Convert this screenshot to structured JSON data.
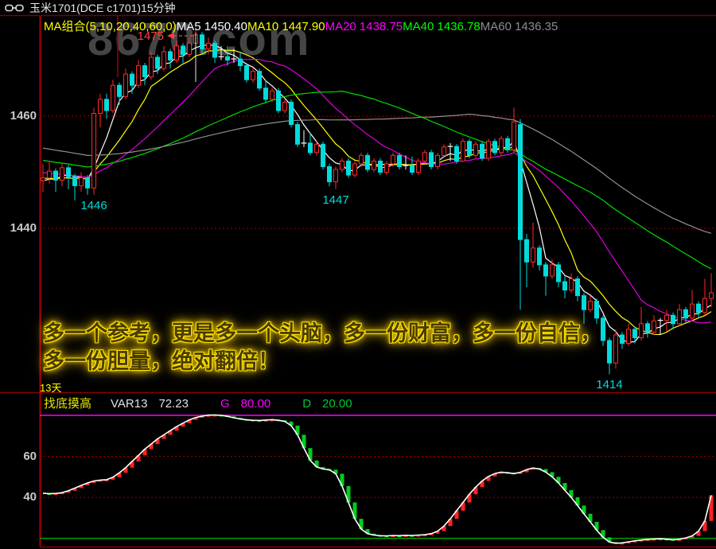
{
  "app": {
    "title": "玉米1701(DCE c1701)15分钟"
  },
  "ma_bar": {
    "group_label": "MA组合(5,10,20,40,60,0)",
    "items": [
      {
        "label": "MA5 1450.40",
        "color": "#ffffff"
      },
      {
        "label": "MA10 1447.90",
        "color": "#ffff00"
      },
      {
        "label": "MA20 1438.75",
        "color": "#ff00ff"
      },
      {
        "label": "MA40 1436.78",
        "color": "#00ff00"
      },
      {
        "label": "MA60 1436.35",
        "color": "#8c8c8c"
      }
    ]
  },
  "watermark": "8670.com",
  "overlay_text": {
    "line1": "多一个参考，更是多一个头脑，多一份财富，多一份自信，",
    "line2": "多一份胆量，绝对翻倍！"
  },
  "period_label": "13天",
  "indicator_header": {
    "name": "找底摸高",
    "var_label": "VAR13",
    "var_value": "72.23",
    "g_label": "G",
    "g_value": "80.00",
    "d_label": "D",
    "d_value": "20.00"
  },
  "colors": {
    "up": "#ff2a2a",
    "down": "#00dcdc",
    "doji": "#ffffff",
    "ma": [
      "#ffffff",
      "#ffff00",
      "#e000e0",
      "#00dd00",
      "#909090"
    ],
    "grid": "#9c0000",
    "axis": "#b40000",
    "separator": "#7a0000",
    "bottom_border": "#6e0000",
    "overbought_line": "#ff00ff",
    "oversold_line": "#00a000",
    "bar_up": "#ff2222",
    "bar_down": "#00cc22",
    "curve": "#ffffff",
    "label_gray": "#c8c8c8",
    "label_cyan": "#00dcdc",
    "label_red": "#ff4040",
    "cursor_line": "#e8e8e8",
    "accent_yellow": "#ffff00"
  },
  "chart_data": [
    {
      "type": "candlestick",
      "symbol": "玉米1701(DCE c1701)",
      "interval": "15分钟",
      "ylim": [
        1411,
        1478
      ],
      "y_ticks": [
        {
          "label": "1460",
          "value": 1460
        },
        {
          "label": "1440",
          "value": 1440
        }
      ],
      "gridline_values": [
        1460,
        1440
      ],
      "ma_periods": [
        5,
        10,
        20,
        40,
        60
      ],
      "lead_in": {
        "start": 1461,
        "end": 1448,
        "count": 60
      },
      "annotations": [
        {
          "type": "high-pointer",
          "text": "1475",
          "x_index": 24,
          "price": 1475.4
        },
        {
          "type": "low-label",
          "text": "1446",
          "x_index": 8,
          "price": 1446
        },
        {
          "type": "low-label",
          "text": "1447",
          "x_index": 46,
          "price": 1447
        },
        {
          "type": "low-label",
          "text": "1414",
          "x_index": 89,
          "price": 1414
        }
      ],
      "candles": [
        [
          1448.5,
          1451.5,
          1446.5,
          1449.0
        ],
        [
          1449.0,
          1452.0,
          1448.0,
          1450.2
        ],
        [
          1450.2,
          1450.7,
          1446.5,
          1448.6
        ],
        [
          1448.6,
          1451.5,
          1447.5,
          1450.8
        ],
        [
          1450.8,
          1451.3,
          1447.0,
          1449.2
        ],
        [
          1449.2,
          1449.7,
          1445.0,
          1447.6
        ],
        [
          1447.6,
          1450.0,
          1446.5,
          1449.0
        ],
        [
          1449.0,
          1449.5,
          1446.0,
          1447.2
        ],
        [
          1447.2,
          1461.5,
          1446.0,
          1460.5
        ],
        [
          1460.5,
          1464.0,
          1458.0,
          1463.0
        ],
        [
          1463.0,
          1464.0,
          1459.5,
          1461.0
        ],
        [
          1461.0,
          1466.5,
          1460.5,
          1465.5
        ],
        [
          1465.5,
          1466.0,
          1462.0,
          1463.5
        ],
        [
          1463.5,
          1468.5,
          1463.0,
          1467.5
        ],
        [
          1467.5,
          1468.0,
          1464.0,
          1465.5
        ],
        [
          1465.5,
          1470.0,
          1465.0,
          1469.0
        ],
        [
          1469.0,
          1469.5,
          1465.5,
          1467.0
        ],
        [
          1467.0,
          1471.5,
          1466.5,
          1470.5
        ],
        [
          1470.5,
          1471.0,
          1467.5,
          1468.5
        ],
        [
          1468.5,
          1472.5,
          1468.0,
          1471.5
        ],
        [
          1471.5,
          1472.0,
          1468.5,
          1470.0
        ],
        [
          1470.0,
          1473.5,
          1469.5,
          1472.5
        ],
        [
          1472.5,
          1473.0,
          1469.5,
          1471.0
        ],
        [
          1471.0,
          1474.0,
          1470.5,
          1473.0
        ],
        [
          1473.0,
          1475.4,
          1471.5,
          1474.5
        ],
        [
          1474.5,
          1475.0,
          1471.0,
          1472.0
        ],
        [
          1472.0,
          1474.0,
          1471.0,
          1473.0
        ],
        [
          1473.0,
          1473.5,
          1469.5,
          1470.5
        ],
        [
          1470.5,
          1472.5,
          1470.0,
          1470.6
        ],
        [
          1470.6,
          1472.5,
          1469.0,
          1470.0
        ],
        [
          1470.0,
          1472.0,
          1469.5,
          1470.2
        ],
        [
          1470.2,
          1471.5,
          1468.0,
          1469.0
        ],
        [
          1469.0,
          1469.5,
          1466.0,
          1466.5
        ],
        [
          1466.5,
          1468.5,
          1466.0,
          1468.0
        ],
        [
          1468.0,
          1468.5,
          1464.5,
          1465.0
        ],
        [
          1465.0,
          1466.5,
          1462.5,
          1463.0
        ],
        [
          1463.0,
          1465.0,
          1462.5,
          1464.5
        ],
        [
          1464.5,
          1465.0,
          1460.5,
          1461.0
        ],
        [
          1461.0,
          1463.0,
          1460.5,
          1462.5
        ],
        [
          1462.5,
          1463.0,
          1458.0,
          1458.5
        ],
        [
          1458.5,
          1459.0,
          1454.5,
          1455.0
        ],
        [
          1455.0,
          1457.5,
          1454.5,
          1455.2
        ],
        [
          1455.2,
          1457.0,
          1453.0,
          1453.5
        ],
        [
          1453.5,
          1455.5,
          1453.0,
          1455.0
        ],
        [
          1455.0,
          1455.5,
          1450.5,
          1451.0
        ],
        [
          1451.0,
          1451.5,
          1447.5,
          1448.3
        ],
        [
          1448.3,
          1451.0,
          1447.0,
          1450.5
        ],
        [
          1450.5,
          1452.5,
          1450.0,
          1452.0
        ],
        [
          1452.0,
          1452.5,
          1449.0,
          1449.5
        ],
        [
          1449.5,
          1452.0,
          1449.0,
          1451.5
        ],
        [
          1451.5,
          1453.5,
          1451.0,
          1453.0
        ],
        [
          1453.0,
          1453.5,
          1450.0,
          1450.5
        ],
        [
          1450.5,
          1452.5,
          1450.0,
          1452.0
        ],
        [
          1452.0,
          1452.5,
          1449.5,
          1450.0
        ],
        [
          1450.0,
          1452.0,
          1449.5,
          1451.5
        ],
        [
          1451.5,
          1453.5,
          1451.0,
          1453.0
        ],
        [
          1453.0,
          1453.5,
          1450.5,
          1451.0
        ],
        [
          1451.0,
          1453.0,
          1450.5,
          1451.2
        ],
        [
          1451.2,
          1452.8,
          1449.5,
          1450.0
        ],
        [
          1450.0,
          1452.5,
          1449.5,
          1452.0
        ],
        [
          1452.0,
          1454.0,
          1451.5,
          1453.5
        ],
        [
          1453.5,
          1454.0,
          1450.5,
          1451.0
        ],
        [
          1451.0,
          1453.5,
          1450.5,
          1453.0
        ],
        [
          1453.0,
          1455.0,
          1452.5,
          1454.5
        ],
        [
          1454.5,
          1455.2,
          1452.0,
          1454.6
        ],
        [
          1454.6,
          1455.0,
          1451.5,
          1452.0
        ],
        [
          1452.0,
          1456.0,
          1451.8,
          1455.5
        ],
        [
          1455.5,
          1456.0,
          1452.5,
          1453.0
        ],
        [
          1453.0,
          1455.5,
          1452.5,
          1455.0
        ],
        [
          1455.0,
          1455.5,
          1452.0,
          1452.5
        ],
        [
          1452.5,
          1456.0,
          1452.0,
          1455.5
        ],
        [
          1455.5,
          1456.0,
          1453.0,
          1453.5
        ],
        [
          1453.5,
          1456.5,
          1453.0,
          1456.0
        ],
        [
          1456.0,
          1456.5,
          1453.5,
          1454.0
        ],
        [
          1454.0,
          1461.5,
          1453.5,
          1459.0
        ],
        [
          1458.5,
          1459.5,
          1425.5,
          1438.0
        ],
        [
          1438.0,
          1439.0,
          1429.5,
          1434.0
        ],
        [
          1434.0,
          1441.0,
          1433.0,
          1436.5
        ],
        [
          1436.5,
          1437.0,
          1432.5,
          1433.5
        ],
        [
          1433.5,
          1434.0,
          1428.0,
          1431.5
        ],
        [
          1431.5,
          1434.5,
          1431.0,
          1433.5
        ],
        [
          1433.5,
          1434.0,
          1429.5,
          1430.5
        ],
        [
          1430.5,
          1431.5,
          1427.5,
          1429.0
        ],
        [
          1429.0,
          1432.0,
          1428.5,
          1431.0
        ],
        [
          1431.0,
          1431.5,
          1427.0,
          1428.0
        ],
        [
          1428.0,
          1428.5,
          1423.0,
          1425.5
        ],
        [
          1425.5,
          1428.0,
          1425.0,
          1427.0
        ],
        [
          1427.0,
          1427.5,
          1423.0,
          1424.0
        ],
        [
          1424.0,
          1424.5,
          1419.0,
          1420.0
        ],
        [
          1420.0,
          1420.5,
          1414.0,
          1416.0
        ],
        [
          1416.0,
          1422.0,
          1415.0,
          1421.0
        ],
        [
          1421.0,
          1421.5,
          1418.5,
          1419.5
        ],
        [
          1419.5,
          1423.0,
          1419.0,
          1422.0
        ],
        [
          1422.0,
          1422.5,
          1419.5,
          1420.5
        ],
        [
          1420.5,
          1426.0,
          1420.0,
          1423.0
        ],
        [
          1423.0,
          1423.5,
          1420.5,
          1421.5
        ],
        [
          1421.5,
          1424.5,
          1421.0,
          1423.5
        ],
        [
          1423.5,
          1424.0,
          1421.0,
          1423.6
        ],
        [
          1423.6,
          1425.5,
          1421.5,
          1424.5
        ],
        [
          1424.5,
          1425.0,
          1422.0,
          1423.0
        ],
        [
          1423.0,
          1426.5,
          1422.5,
          1425.5
        ],
        [
          1425.5,
          1426.0,
          1423.0,
          1424.0
        ],
        [
          1424.0,
          1429.0,
          1423.5,
          1426.5
        ],
        [
          1426.5,
          1427.0,
          1424.0,
          1425.0
        ],
        [
          1425.0,
          1431.0,
          1424.5,
          1427.5
        ],
        [
          1427.5,
          1432.0,
          1426.0,
          1428.5
        ]
      ]
    },
    {
      "type": "bar",
      "name": "VAR13",
      "ylim": [
        16,
        83
      ],
      "y_ticks": [
        {
          "label": "60",
          "value": 60
        },
        {
          "label": "40",
          "value": 40
        }
      ],
      "gridline_values": [
        60,
        40
      ],
      "hlines": [
        {
          "value": 80,
          "color": "#ff00ff"
        },
        {
          "value": 20,
          "color": "#00a000"
        }
      ],
      "values": [
        42.0,
        41.8,
        41.9,
        42.3,
        43.2,
        44.5,
        45.8,
        47.0,
        48.0,
        48.4,
        48.6,
        49.8,
        52.0,
        54.5,
        57.5,
        60.5,
        63.5,
        66.0,
        68.5,
        70.5,
        72.5,
        74.5,
        76.2,
        77.8,
        78.9,
        79.6,
        80.1,
        80.2,
        80.0,
        79.5,
        78.8,
        78.2,
        77.8,
        77.6,
        77.5,
        77.7,
        77.9,
        77.6,
        77.0,
        75.0,
        70.5,
        64.0,
        58.0,
        54.8,
        53.8,
        53.5,
        51.5,
        45.5,
        37.5,
        29.5,
        24.5,
        22.3,
        21.6,
        21.3,
        21.2,
        21.4,
        21.3,
        21.5,
        21.4,
        21.6,
        21.8,
        22.3,
        23.5,
        26.0,
        29.5,
        33.5,
        37.5,
        41.5,
        45.0,
        48.0,
        50.2,
        51.6,
        52.3,
        52.0,
        51.6,
        52.2,
        53.5,
        54.3,
        53.8,
        52.3,
        50.0,
        47.0,
        43.5,
        40.0,
        36.0,
        32.0,
        28.0,
        24.0,
        20.5,
        18.2,
        17.6,
        17.8,
        18.3,
        18.8,
        19.2,
        19.5,
        19.7,
        19.8,
        19.6,
        19.3,
        19.6,
        20.2,
        21.2,
        23.5,
        28.5,
        41.0
      ]
    }
  ]
}
